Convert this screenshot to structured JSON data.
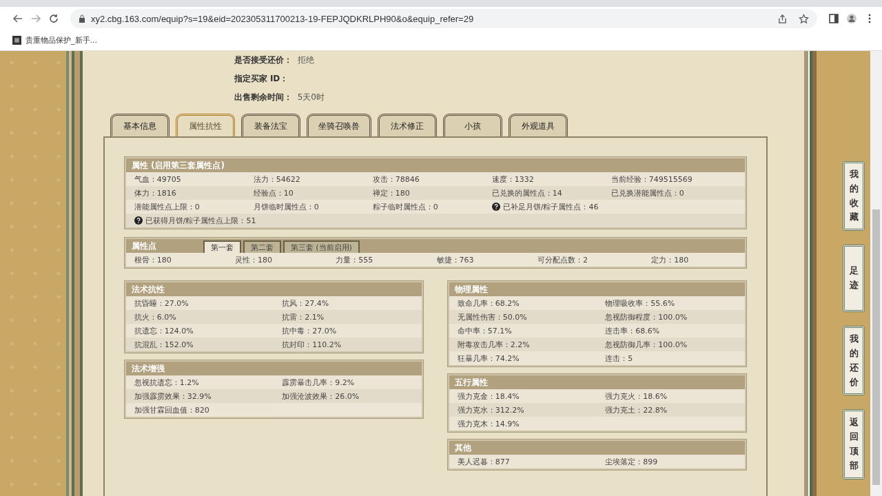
{
  "browser": {
    "url": "xy2.cbg.163.com/equip?s=19&eid=202305311700213-19-FEPJQDKRLPH90&o&equip_refer=29",
    "bookmark": "贵重物品保护_新手..."
  },
  "info": [
    {
      "label": "是否接受还价：",
      "value": "拒绝"
    },
    {
      "label": "指定买家 ID："
    },
    {
      "label": "出售剩余时间：",
      "value": "5天0时"
    }
  ],
  "tabs": [
    {
      "label": "基本信息",
      "selected": false
    },
    {
      "label": "属性抗性",
      "selected": true
    },
    {
      "label": "装备法宝",
      "selected": false
    },
    {
      "label": "坐骑召唤兽",
      "selected": false
    },
    {
      "label": "法术修正",
      "selected": false
    },
    {
      "label": "小孩",
      "selected": false
    },
    {
      "label": "外观道具",
      "selected": false
    }
  ],
  "attributes": {
    "title": "属性 (启用第三套属性点)",
    "rows": [
      [
        {
          "text": "气血：49705",
          "help": false
        },
        {
          "text": "法力：54622",
          "help": false
        },
        {
          "text": "攻击：78846",
          "help": false
        },
        {
          "text": "速度：1332",
          "help": false
        },
        {
          "text": "当前经验：749515569",
          "help": false
        }
      ],
      [
        {
          "text": "体力：1816",
          "help": false
        },
        {
          "text": "经验点：10",
          "help": false
        },
        {
          "text": "禅定：180",
          "help": false
        },
        {
          "text": "已兑换的属性点：14",
          "help": false
        },
        {
          "text": "已兑换潜能属性点：0",
          "help": false
        }
      ],
      [
        {
          "text": "潜能属性点上限：0",
          "help": false
        },
        {
          "text": "月饼临时属性点：0",
          "help": false
        },
        {
          "text": "粽子临时属性点：0",
          "help": false
        },
        {
          "text": "已补足月饼/粽子属性点：46",
          "help": true
        }
      ],
      [
        {
          "text": "已获得月饼/粽子属性点上限：51",
          "help": true
        }
      ]
    ]
  },
  "points": {
    "title": "属性点",
    "tabs": [
      {
        "label": "第一套",
        "selected": true
      },
      {
        "label": "第二套",
        "selected": false
      },
      {
        "label": "第三套 (当前启用)",
        "selected": false
      }
    ],
    "values": [
      "根骨：180",
      "灵性：180",
      "力量：555",
      "敏捷：763",
      "可分配点数：2",
      "定力：180"
    ]
  },
  "left_panels": [
    {
      "title": "法术抗性",
      "items": [
        "抗昏睡：27.0%",
        "抗风：27.4%",
        "抗火：6.0%",
        "抗雷：2.1%",
        "抗遗忘：124.0%",
        "抗中毒：27.0%",
        "抗混乱：152.0%",
        "抗封印：110.2%"
      ]
    },
    {
      "title": "法术增强",
      "items": [
        "忽视抗遗忘：1.2%",
        "霹雳暴击几率：9.2%",
        "加强霹雳效果：32.9%",
        "加强沧波效果：26.0%",
        "加强甘霖回血值：820"
      ]
    }
  ],
  "right_panels": [
    {
      "title": "物理属性",
      "items": [
        "致命几率：68.2%",
        "物理吸收率：55.6%",
        "无属性伤害：50.0%",
        "忽视防御程度：100.0%",
        "命中率：57.1%",
        "连击率：68.6%",
        "附毒攻击几率：2.2%",
        "忽视防御几率：100.0%",
        "狂暴几率：74.2%",
        "连击：5"
      ]
    },
    {
      "title": "五行属性",
      "items": [
        "强力克金：18.4%",
        "强力克火：18.6%",
        "强力克水：312.2%",
        "强力克土：22.8%",
        "强力克木：14.9%"
      ]
    },
    {
      "title": "其他",
      "items": [
        "美人迟暮：877",
        "尘埃落定：899"
      ]
    }
  ],
  "side_buttons": [
    "我的收藏",
    "足迹",
    "我的还价",
    "返回顶部"
  ]
}
